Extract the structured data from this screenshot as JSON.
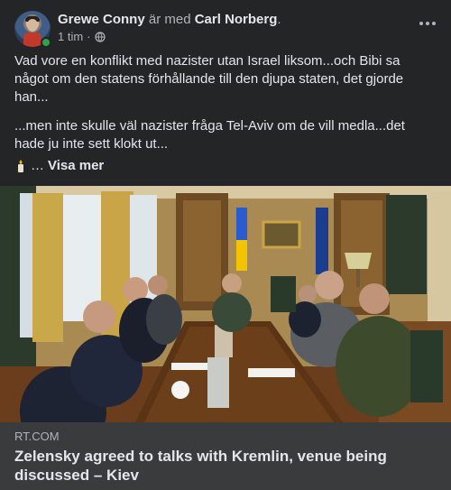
{
  "post": {
    "author": "Grewe Conny",
    "with_text": " är med ",
    "tagged": "Carl Norberg",
    "period": ".",
    "time": "1 tim",
    "separator": "·",
    "privacy_icon": "globe-icon",
    "more_icon": "more-options-icon",
    "paragraphs": [
      "Vad vore en konflikt med nazister utan Israel liksom...och Bibi sa något om den statens förhållande till den djupa staten, det gjorde han...",
      "...men inte skulle väl nazister fråga Tel-Aviv om de vill medla...det hade ju inte sett klokt ut..."
    ],
    "emoji_icon": "candle-emoji-icon",
    "ellipsis": "…",
    "see_more": "Visa mer"
  },
  "link": {
    "image_icon": "meeting-photo",
    "source": "RT.COM",
    "headline": "Zelensky agreed to talks with Kremlin, venue being discussed – Kiev"
  },
  "colors": {
    "background": "#242526",
    "link_meta_bg": "#3a3b3c",
    "primary_text": "#e4e6eb",
    "secondary_text": "#b0b3b8",
    "online": "#31a24c"
  }
}
